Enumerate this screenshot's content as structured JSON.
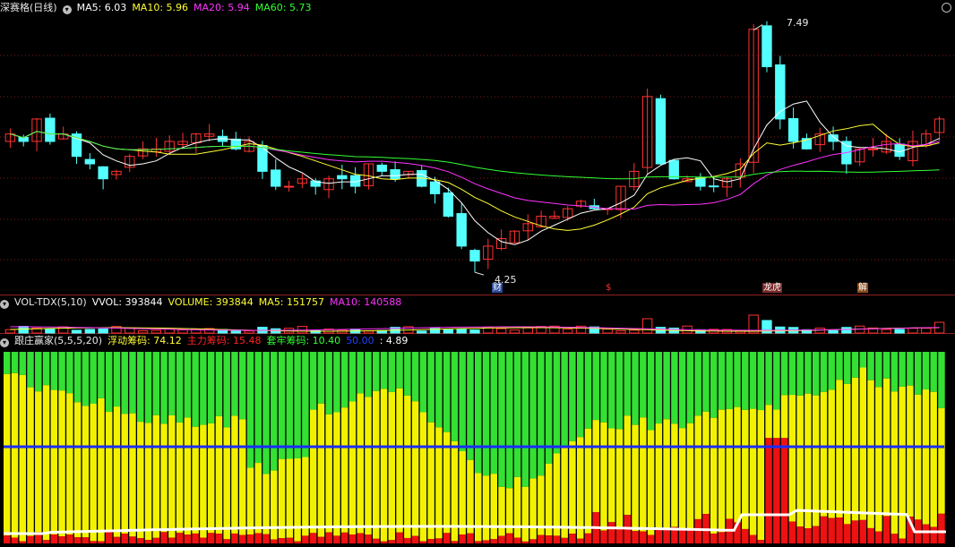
{
  "main_panel": {
    "title": "深赛格(日线)",
    "icon": "chevron-down-icon",
    "indicators": [
      {
        "label": "MA5: 6.03",
        "color": "#ffffff"
      },
      {
        "label": "MA10: 5.96",
        "color": "#ffff33"
      },
      {
        "label": "MA20: 5.94",
        "color": "#ff33ff"
      },
      {
        "label": "MA60: 5.73",
        "color": "#33ff33"
      }
    ],
    "high_label": "7.49",
    "low_label": "4.25",
    "event_tags": [
      "财",
      "$",
      "龙虎",
      "解"
    ],
    "corner_icon": "circle-icon"
  },
  "volume_panel": {
    "title": "VOL-TDX(5,10)",
    "indicators": [
      {
        "label": "VVOL: 393844",
        "color": "#ffffff"
      },
      {
        "label": "VOLUME: 393844",
        "color": "#ffff33"
      },
      {
        "label": "MA5: 151757",
        "color": "#ffff33"
      },
      {
        "label": "MA10: 140588",
        "color": "#ff33ff"
      }
    ]
  },
  "chip_panel": {
    "title": "跟庄赢家(5,5,5,20)",
    "indicators": [
      {
        "label": "浮动筹码: 74.12",
        "color": "#ffff33"
      },
      {
        "label": "主力筹码: 15.48",
        "color": "#ff2222"
      },
      {
        "label": "套牢筹码: 10.40",
        "color": "#33ff33"
      },
      {
        "label": "50.00",
        "color": "#2040ff"
      },
      {
        "label": ": 4.89",
        "color": "#ffffff"
      }
    ]
  },
  "chart_data": [
    {
      "type": "candlestick",
      "title": "深赛格(日线)",
      "y_range": [
        4.0,
        7.7
      ],
      "ohlc_approx_close": [
        6.1,
        6.0,
        6.3,
        6.0,
        6.1,
        5.8,
        5.7,
        5.5,
        5.6,
        5.8,
        5.9,
        5.9,
        6.0,
        6.0,
        6.1,
        6.1,
        6.0,
        5.9,
        6.0,
        5.6,
        5.4,
        5.4,
        5.5,
        5.4,
        5.5,
        5.5,
        5.4,
        5.7,
        5.6,
        5.5,
        5.6,
        5.4,
        5.3,
        5.0,
        4.6,
        4.4,
        4.6,
        4.7,
        4.8,
        4.9,
        5.0,
        5.0,
        5.1,
        5.2,
        5.1,
        5.1,
        5.4,
        5.6,
        6.6,
        5.7,
        5.5,
        5.5,
        5.4,
        5.4,
        5.5,
        5.7,
        7.5,
        7.0,
        6.3,
        6.0,
        5.9,
        6.1,
        6.0,
        5.7,
        5.9,
        5.9,
        6.0,
        5.8,
        6.0,
        6.1,
        6.3
      ],
      "annotations": [
        "7.49 (high)",
        "4.25 (low)"
      ]
    },
    {
      "type": "bar",
      "title": "VOL-TDX(5,10)",
      "series": [
        {
          "name": "VOLUME",
          "last": 393844
        },
        {
          "name": "MA5",
          "last": 151757
        },
        {
          "name": "MA10",
          "last": 140588
        }
      ]
    },
    {
      "type": "bar",
      "title": "跟庄赢家(5,5,5,20)",
      "series": [
        {
          "name": "浮动筹码",
          "last": 74.12
        },
        {
          "name": "主力筹码",
          "last": 15.48
        },
        {
          "name": "套牢筹码",
          "last": 10.4
        }
      ],
      "reference_line": 50.0,
      "extra_value": 4.89
    }
  ]
}
